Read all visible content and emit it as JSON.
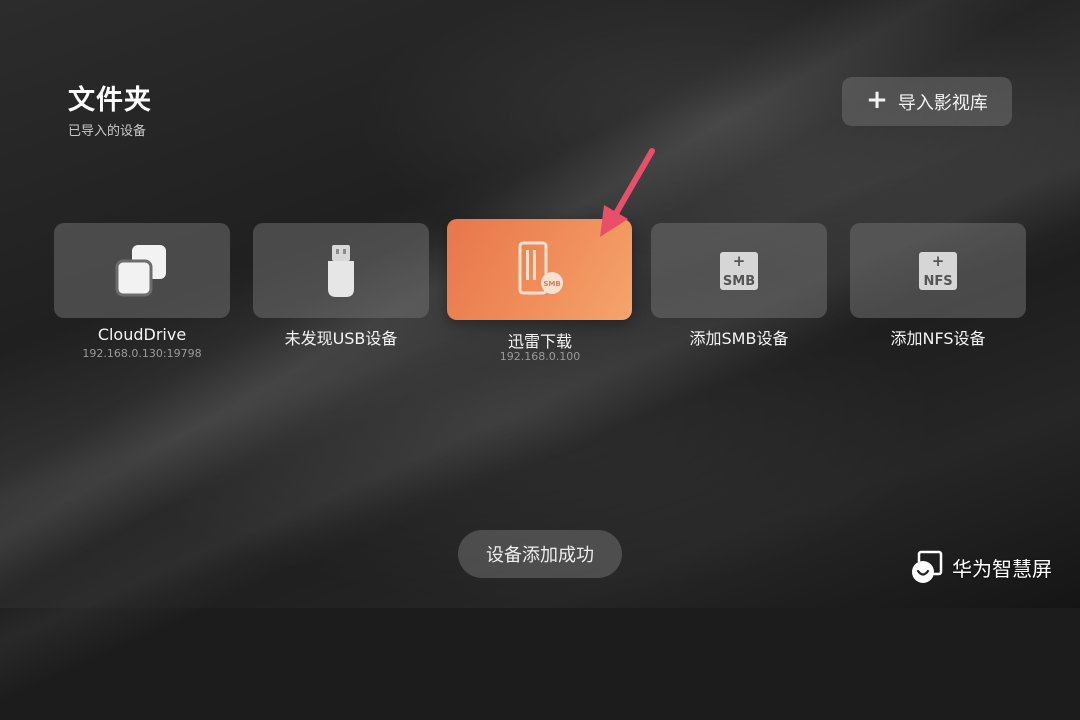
{
  "header": {
    "title": "文件夹",
    "subtitle": "已导入的设备",
    "import_button_label": "导入影视库"
  },
  "devices": [
    {
      "label": "CloudDrive",
      "sublabel": "192.168.0.130:19798",
      "icon": "cloud-drive-icon"
    },
    {
      "label": "未发现USB设备",
      "sublabel": "",
      "icon": "usb-drive-icon"
    },
    {
      "label": "迅雷下载",
      "sublabel": "192.168.0.100",
      "icon": "smb-server-icon",
      "selected": true
    },
    {
      "label": "添加SMB设备",
      "sublabel": "",
      "icon": "add-smb-icon",
      "badge": "SMB"
    },
    {
      "label": "添加NFS设备",
      "sublabel": "",
      "icon": "add-nfs-icon",
      "badge": "NFS"
    }
  ],
  "toast": {
    "message": "设备添加成功"
  },
  "watermark": {
    "text": "华为智慧屏"
  },
  "colors": {
    "accent": "#ee8453",
    "card_bg": "#5a5a5a",
    "arrow": "#e8506a"
  }
}
